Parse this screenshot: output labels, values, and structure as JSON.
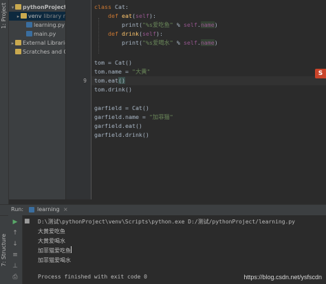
{
  "side_tabs": {
    "project": "1: Project",
    "structure": "7: Structure"
  },
  "project_tree": [
    {
      "label": "pythonProject",
      "indent": 1,
      "expanded": true,
      "icon": "folder-icon",
      "bold": true
    },
    {
      "label": "venv",
      "suffix": "library r",
      "indent": 2,
      "expanded": false,
      "icon": "folder-icon",
      "selected": true
    },
    {
      "label": "learning.py",
      "indent": 3,
      "icon": "python-file-icon"
    },
    {
      "label": "main.py",
      "indent": 3,
      "icon": "python-file-icon"
    },
    {
      "label": "External Librarie",
      "indent": 1,
      "expanded": false,
      "icon": "library-icon"
    },
    {
      "label": "Scratches and Co",
      "indent": 1,
      "icon": "scratches-icon"
    }
  ],
  "line_numbers": [
    "",
    "",
    "",
    "",
    "",
    "",
    "",
    "",
    "9",
    "",
    "",
    "",
    "",
    "",
    "",
    ""
  ],
  "editor": {
    "lines": [
      "class Cat:",
      "    def eat(self):",
      "        print(\"%s爱吃鱼\" % self.name)",
      "    def drink(self):",
      "        print(\"%s爱喝水\" % self.name)",
      "",
      "tom = Cat()",
      "tom.name = \"大黄\"",
      "tom.eat()",
      "tom.drink()",
      "",
      "garfield = Cat()",
      "garfield.name = \"加菲猫\"",
      "garfield.eat()",
      "garfield.drink()"
    ],
    "tokens": {
      "class_kw": "class",
      "class_name": " Cat:",
      "def_kw": "def",
      "eat_fn": "eat",
      "drink_fn": "drink",
      "self": "self",
      "print": "print(",
      "fmt1": "\"%s爱吃鱼\"",
      "fmt2": "\"%s爱喝水\"",
      "pct": " % ",
      "name_attr": "name",
      "tom_assign": "tom = Cat()",
      "tom_name_pre": "tom.name = ",
      "tom_name_str": "\"大黄\"",
      "tom_eat_pre": "tom.eat",
      "parens": "()",
      "tom_drink": "tom.drink()",
      "gar_assign": "garfield = Cat()",
      "gar_name_pre": "garfield.name = ",
      "gar_name_str": "\"加菲猫\"",
      "gar_eat": "garfield.eat()",
      "gar_drink": "garfield.drink()"
    },
    "badge": "S"
  },
  "run_panel": {
    "label": "Run:",
    "config": "learning",
    "output": [
      "D:\\测试\\pythonProject\\venv\\Scripts\\python.exe D:/测试/pythonProject/learning.py",
      "大黄爱吃鱼",
      "大黄爱喝水",
      "加菲猫爱吃鱼",
      "加菲猫爱喝水",
      "",
      "Process finished with exit code 0"
    ]
  },
  "watermark": "https://blog.csdn.net/ysfscdn"
}
